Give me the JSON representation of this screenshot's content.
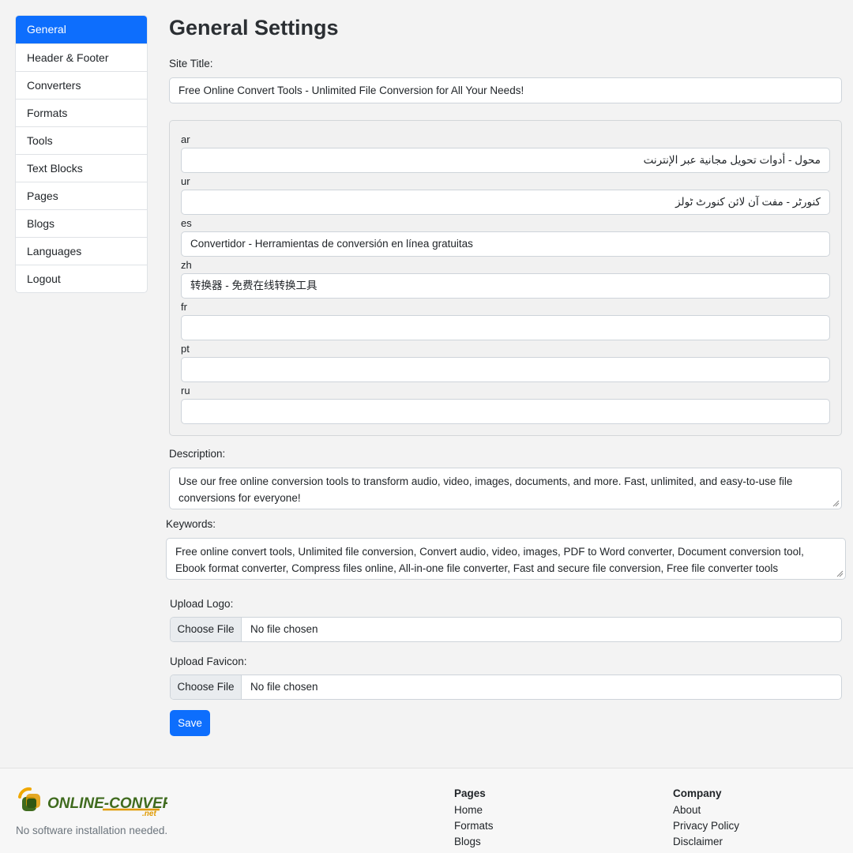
{
  "sidebar": {
    "items": [
      {
        "label": "General",
        "active": true
      },
      {
        "label": "Header & Footer"
      },
      {
        "label": "Converters"
      },
      {
        "label": "Formats"
      },
      {
        "label": "Tools"
      },
      {
        "label": "Text Blocks"
      },
      {
        "label": "Pages"
      },
      {
        "label": "Blogs"
      },
      {
        "label": "Languages"
      },
      {
        "label": "Logout"
      }
    ],
    "accent_color": "#0d6efd"
  },
  "main": {
    "title": "General Settings",
    "site_title": {
      "label": "Site Title:",
      "value": "Free Online Convert Tools - Unlimited File Conversion for All Your Needs!"
    },
    "translations": [
      {
        "code": "ar",
        "value": "محول - أدوات تحويل مجانية عبر الإنترنت"
      },
      {
        "code": "ur",
        "value": "کنورٹر - مفت آن لائن کنورٹ ٹولز"
      },
      {
        "code": "es",
        "value": "Convertidor - Herramientas de conversión en línea gratuitas"
      },
      {
        "code": "zh",
        "value": "转换器 - 免费在线转换工具"
      },
      {
        "code": "fr",
        "value": ""
      },
      {
        "code": "pt",
        "value": ""
      },
      {
        "code": "ru",
        "value": ""
      }
    ],
    "description": {
      "label": "Description:",
      "value": "Use our free online conversion tools to transform audio, video, images, documents, and more. Fast, unlimited, and easy-to-use file conversions for everyone!"
    },
    "keywords": {
      "label": "Keywords:",
      "value": "Free online convert tools, Unlimited file conversion, Convert audio, video, images, PDF to Word converter, Document conversion tool, Ebook format converter, Compress files online, All-in-one file converter, Fast and secure file conversion, Free file converter tools"
    },
    "upload_logo": {
      "label": "Upload Logo:",
      "button": "Choose File",
      "status": "No file chosen"
    },
    "upload_favicon": {
      "label": "Upload Favicon:",
      "button": "Choose File",
      "status": "No file chosen"
    },
    "save_label": "Save"
  },
  "footer": {
    "logo_text": "ONLINE-CONVERT",
    "logo_suffix": ".net",
    "tagline": "No software installation needed.",
    "pages": {
      "heading": "Pages",
      "links": [
        "Home",
        "Formats",
        "Blogs"
      ]
    },
    "company": {
      "heading": "Company",
      "links": [
        "About",
        "Privacy Policy",
        "Disclaimer"
      ]
    }
  }
}
